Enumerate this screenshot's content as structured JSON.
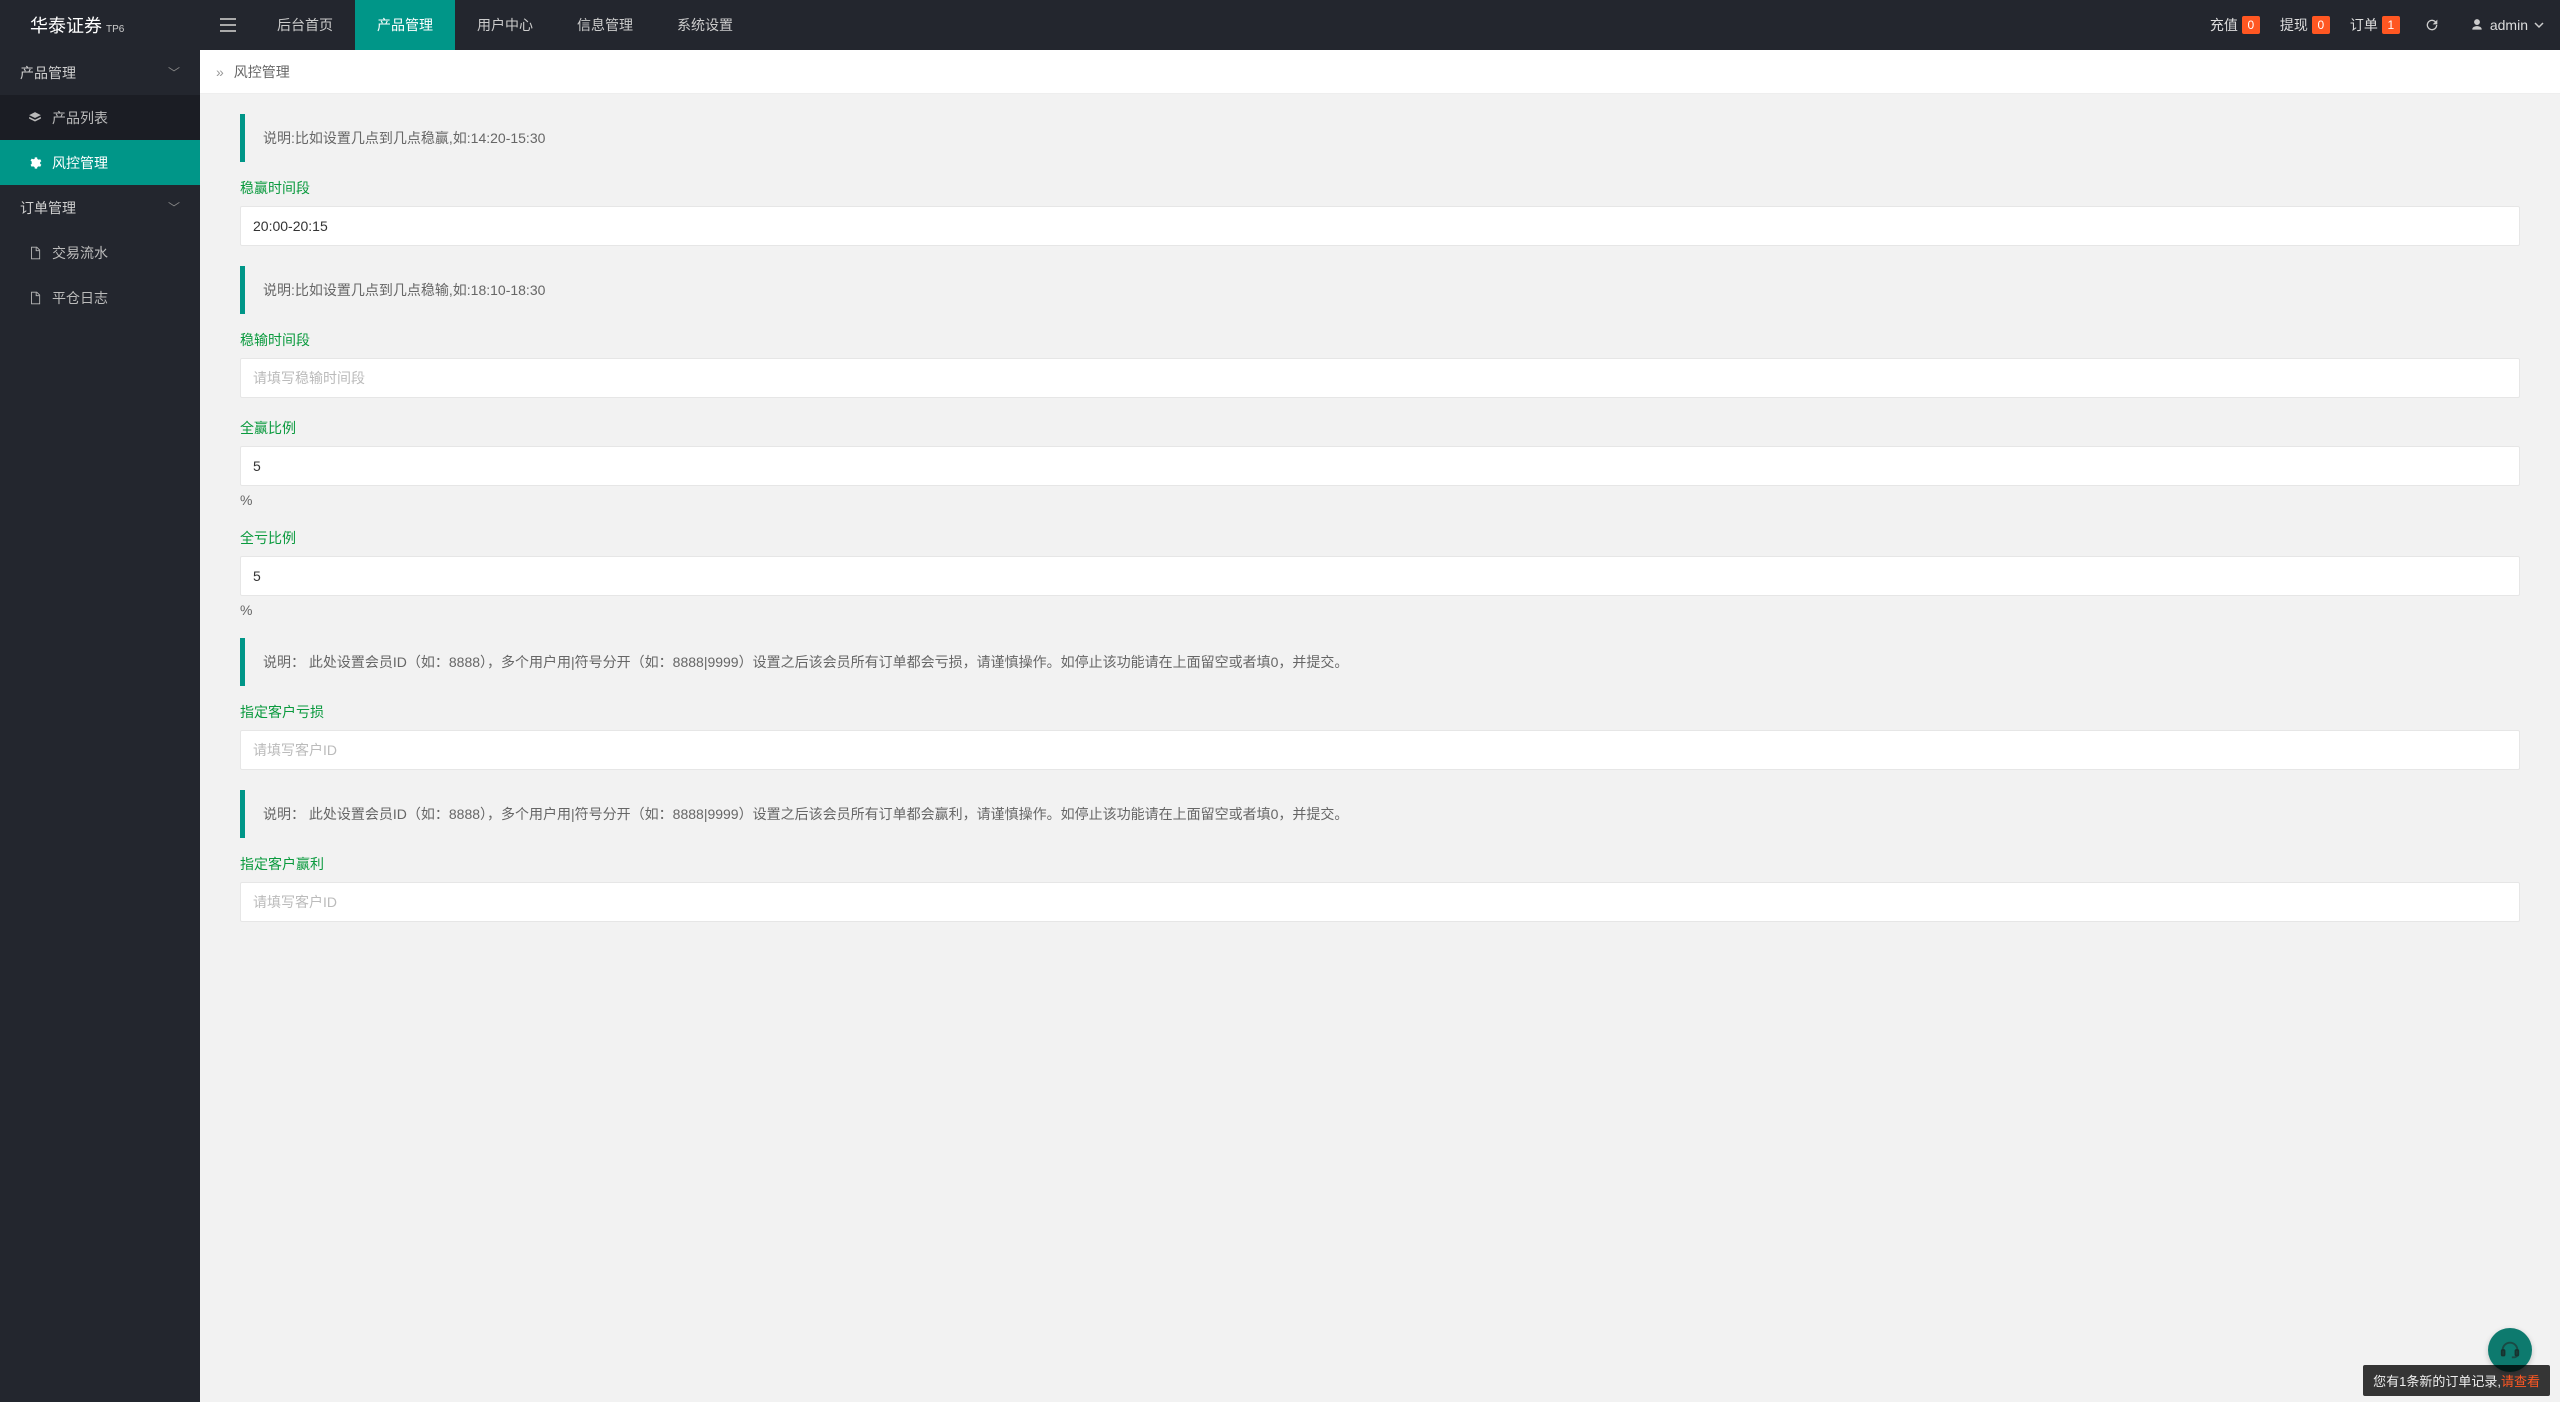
{
  "brand": {
    "name": "华泰证券",
    "sup": "TP6"
  },
  "nav": {
    "home": "后台首页",
    "product": "产品管理",
    "user": "用户中心",
    "info": "信息管理",
    "system": "系统设置"
  },
  "headerRight": {
    "recharge": {
      "label": "充值",
      "count": "0"
    },
    "withdraw": {
      "label": "提现",
      "count": "0"
    },
    "order": {
      "label": "订单",
      "count": "1"
    },
    "user": "admin"
  },
  "sidebar": {
    "productGroup": "产品管理",
    "productList": "产品列表",
    "riskMgmt": "风控管理",
    "orderGroup": "订单管理",
    "tradeFlow": "交易流水",
    "closeLog": "平仓日志"
  },
  "breadcrumb": {
    "current": "风控管理"
  },
  "form": {
    "note1": "说明:比如设置几点到几点稳赢,如:14:20-15:30",
    "winTimeLabel": "稳赢时间段",
    "winTimeValue": "20:00-20:15",
    "note2": "说明:比如设置几点到几点稳输,如:18:10-18:30",
    "loseTimeLabel": "稳输时间段",
    "loseTimePlaceholder": "请填写稳输时间段",
    "allWinLabel": "全赢比例",
    "allWinValue": "5",
    "allLoseLabel": "全亏比例",
    "allLoseValue": "5",
    "percentUnit": "%",
    "note3": "说明： 此处设置会员ID（如：8888），多个用户用|符号分开（如：8888|9999）设置之后该会员所有订单都会亏损，请谨慎操作。如停止该功能请在上面留空或者填0，并提交。",
    "specLoseLabel": "指定客户亏损",
    "specLosePlaceholder": "请填写客户ID",
    "note4": "说明： 此处设置会员ID（如：8888），多个用户用|符号分开（如：8888|9999）设置之后该会员所有订单都会赢利，请谨慎操作。如停止该功能请在上面留空或者填0，并提交。",
    "specWinLabel": "指定客户赢利",
    "specWinPlaceholder": "请填写客户ID"
  },
  "toast": {
    "text": "您有1条新的订单记录,",
    "link": "请查看"
  }
}
